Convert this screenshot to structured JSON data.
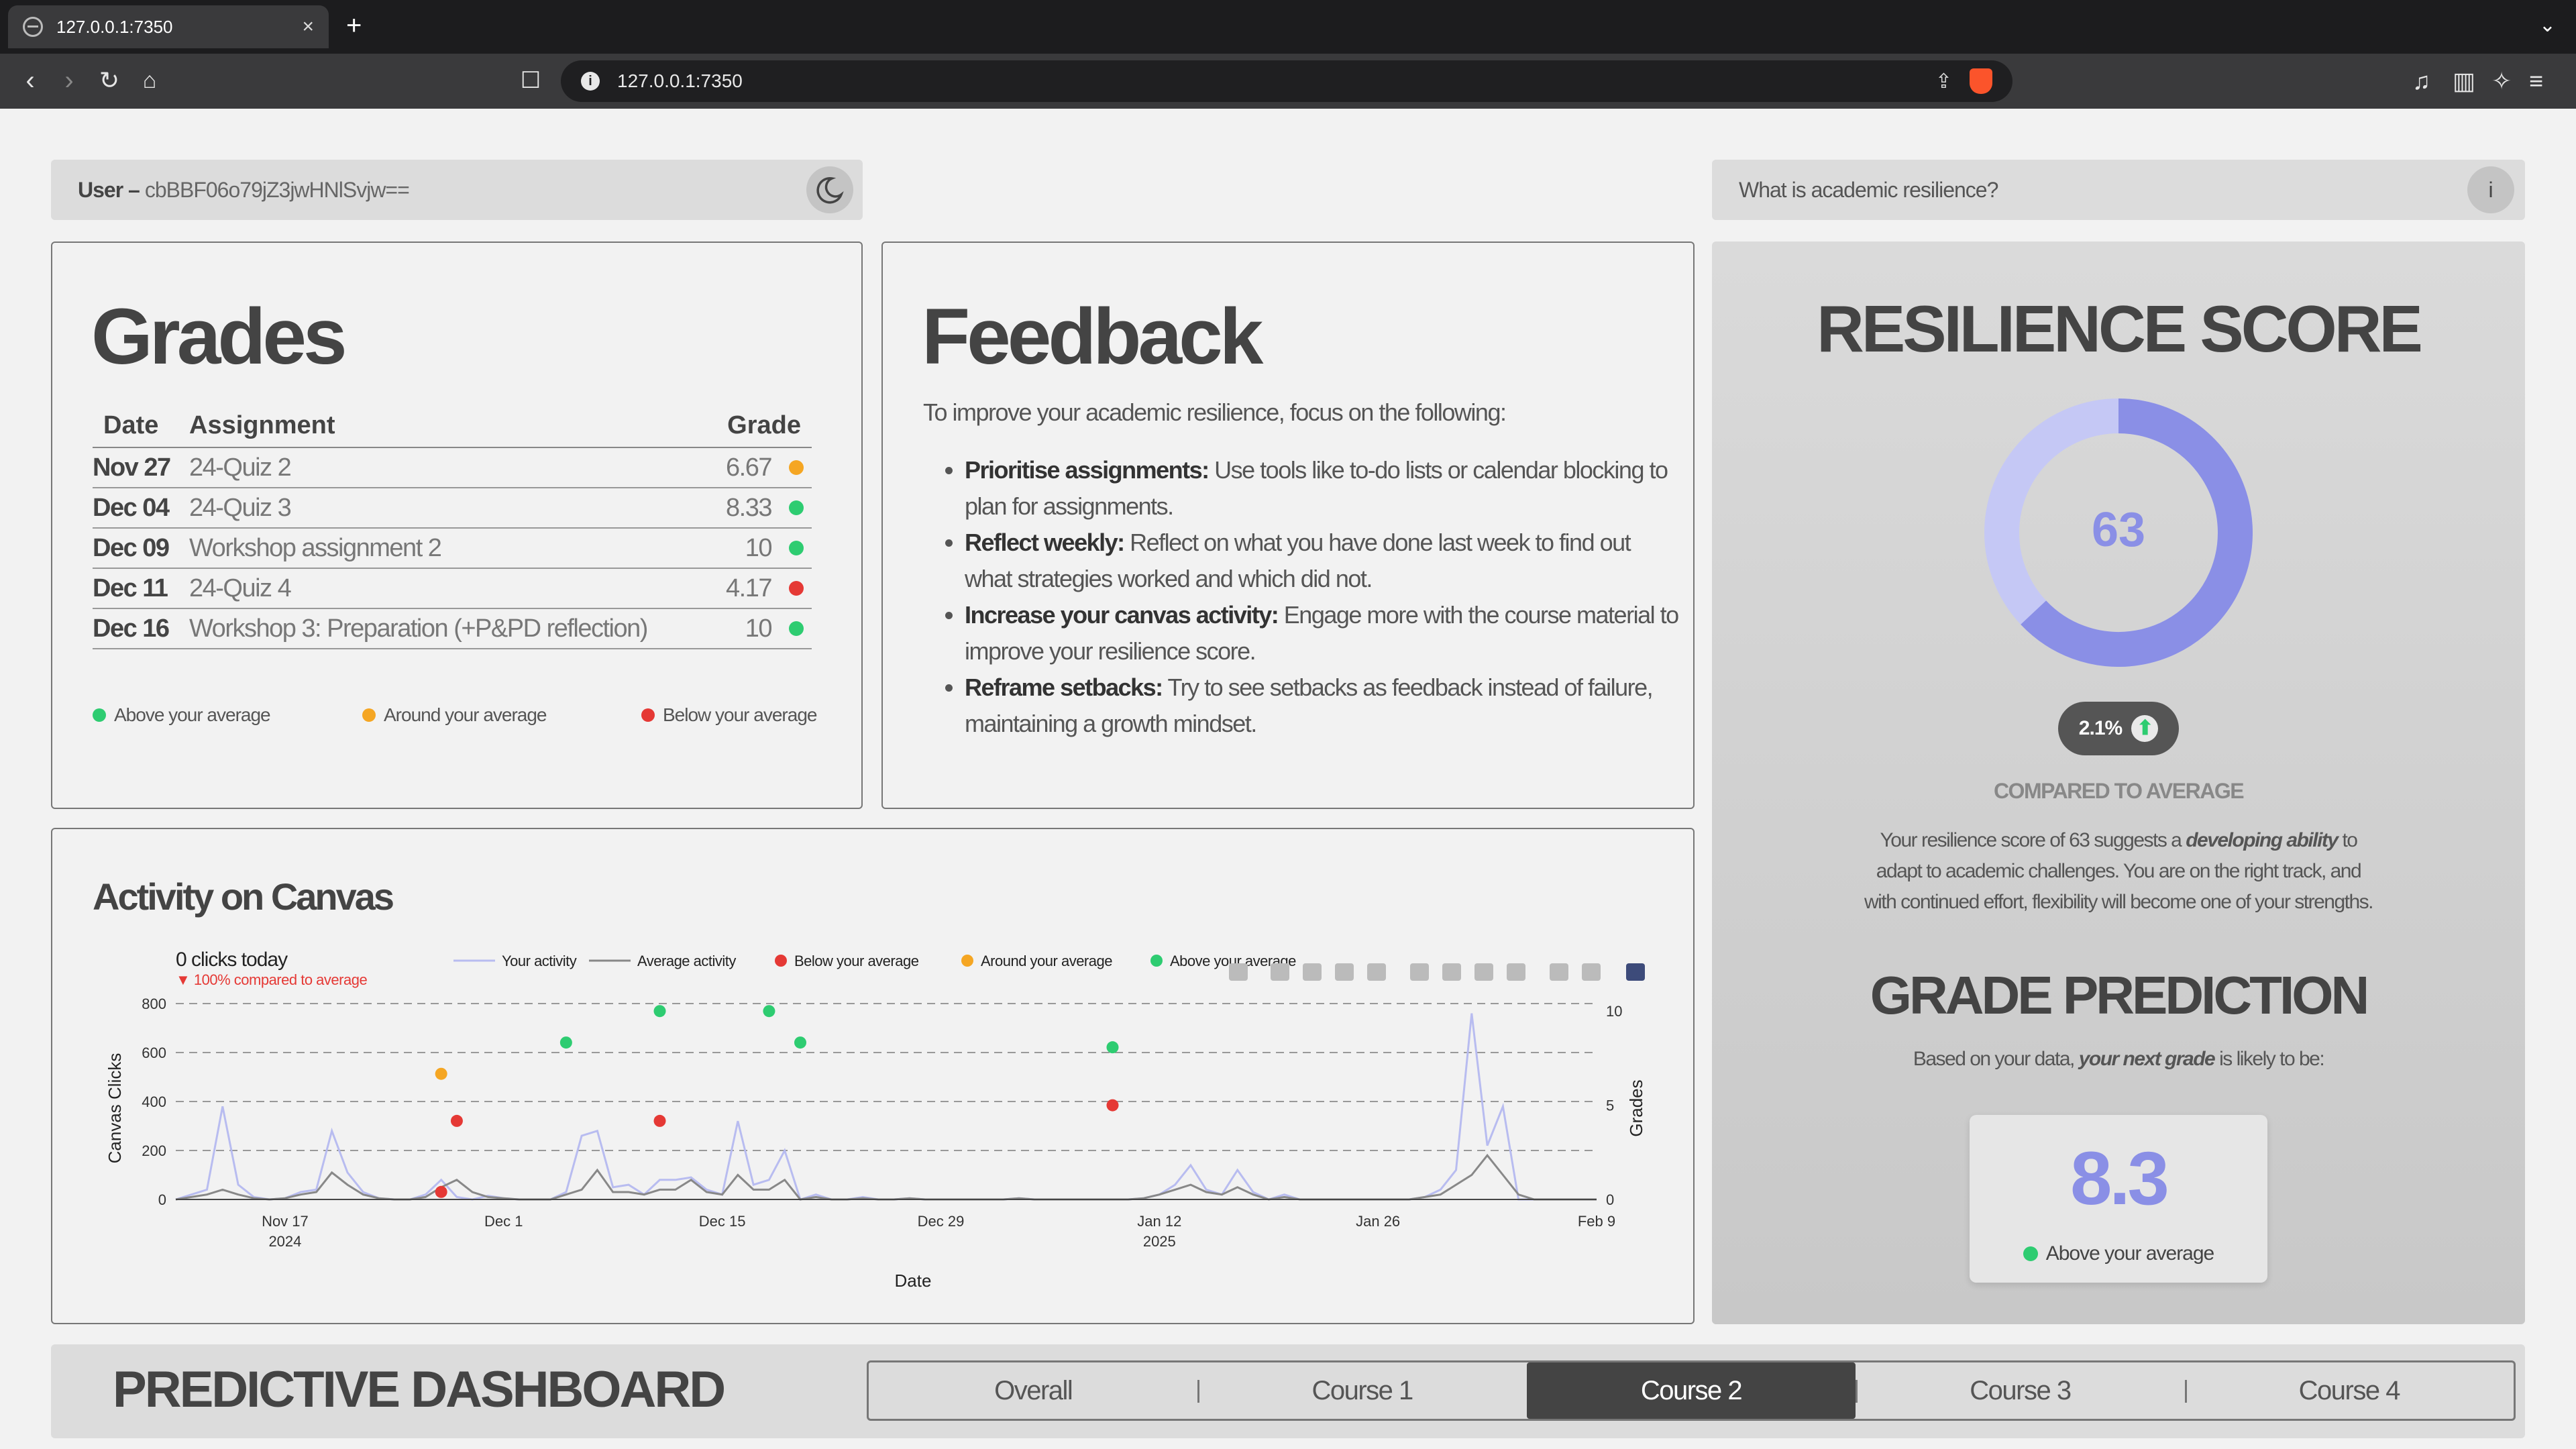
{
  "browser": {
    "tab_title": "127.0.0.1:7350",
    "url": "127.0.0.1:7350"
  },
  "user_bar": {
    "label": "User –",
    "id": "cbBBF06o79jZ3jwHNlSvjw=="
  },
  "info_bar": {
    "question": "What is academic resilience?"
  },
  "grades": {
    "title": "Grades",
    "headers": [
      "Date",
      "Assignment",
      "Grade"
    ],
    "rows": [
      {
        "date": "Nov 27",
        "assignment": "24-Quiz 2",
        "grade": "6.67",
        "status": "around"
      },
      {
        "date": "Dec 04",
        "assignment": "24-Quiz 3",
        "grade": "8.33",
        "status": "above"
      },
      {
        "date": "Dec 09",
        "assignment": "Workshop assignment 2",
        "grade": "10",
        "status": "above"
      },
      {
        "date": "Dec 11",
        "assignment": "24-Quiz 4",
        "grade": "4.17",
        "status": "below"
      },
      {
        "date": "Dec 16",
        "assignment": "Workshop 3: Preparation (+P&PD reflection)",
        "grade": "10",
        "status": "above"
      }
    ],
    "legend": {
      "above": "Above your average",
      "around": "Around your average",
      "below": "Below your average"
    }
  },
  "feedback": {
    "title": "Feedback",
    "intro": "To improve your academic resilience, focus on the following:",
    "items": [
      {
        "bold": "Prioritise assignments:",
        "text": " Use tools like to-do lists or calendar blocking to plan for assignments."
      },
      {
        "bold": "Reflect weekly:",
        "text": " Reflect on what you have done last week to find out what strategies worked and which did not."
      },
      {
        "bold": "Increase your canvas activity:",
        "text": " Engage more with the course material to improve your resilience score."
      },
      {
        "bold": "Reframe setbacks:",
        "text": " Try to see setbacks as feedback instead of failure, maintaining a growth mindset."
      }
    ]
  },
  "resilience": {
    "title": "RESILIENCE SCORE",
    "score": "63",
    "score_fraction": 0.63,
    "delta": "2.1%",
    "compared_label": "COMPARED TO AVERAGE",
    "desc_1": "Your resilience score of 63 suggests a",
    "desc_bold": "developing ability",
    "desc_2": "to",
    "desc_line2": "adapt to academic challenges. You are on the right track, and",
    "desc_line3": "with continued effort, flexibility will become one of your strengths.",
    "grade_title": "GRADE PREDICTION",
    "grade_intro_1": "Based on your data,",
    "grade_intro_bold": "your next grade",
    "grade_intro_2": "is likely to be:",
    "predicted_grade": "8.3",
    "predicted_status": "Above your average"
  },
  "activity": {
    "title": "Activity on Canvas",
    "clicks_today": "0 clicks today",
    "compare": "100% compared to average",
    "legend": [
      "Your activity",
      "Average activity",
      "Below your average",
      "Around your average",
      "Above your average"
    ],
    "ylabel_left": "Canvas Clicks",
    "ylabel_right": "Grades",
    "xlabel": "Date",
    "x_ticks": [
      "Nov 17",
      "Dec 1",
      "Dec 15",
      "Dec 29",
      "Jan 12",
      "Jan 26",
      "Feb 9"
    ],
    "x_years": [
      "2024",
      "",
      "",
      "",
      "2025",
      "",
      ""
    ],
    "y_left_ticks": [
      "0",
      "200",
      "400",
      "600",
      "800"
    ],
    "y_right_ticks": [
      "0",
      "5",
      "10"
    ]
  },
  "chart_data": {
    "type": "line",
    "x_start": "2024-11-10",
    "x_end": "2025-02-09",
    "ylim": [
      0,
      800
    ],
    "y2lim": [
      0,
      10.4
    ],
    "series": [
      {
        "name": "Your activity",
        "color": "#b8bcf0",
        "values": [
          0,
          20,
          40,
          380,
          60,
          10,
          0,
          5,
          30,
          40,
          280,
          110,
          30,
          5,
          0,
          0,
          20,
          80,
          10,
          0,
          15,
          5,
          0,
          0,
          0,
          30,
          260,
          280,
          50,
          60,
          20,
          80,
          80,
          90,
          40,
          20,
          320,
          60,
          80,
          200,
          0,
          20,
          0,
          0,
          10,
          0,
          0,
          5,
          0,
          0,
          0,
          0,
          0,
          0,
          5,
          0,
          0,
          0,
          0,
          0,
          0,
          0,
          5,
          20,
          60,
          140,
          40,
          20,
          120,
          30,
          0,
          20,
          0,
          0,
          0,
          0,
          0,
          0,
          0,
          0,
          10,
          40,
          120,
          760,
          220,
          380,
          0,
          0,
          0,
          0,
          0,
          0
        ]
      },
      {
        "name": "Average activity",
        "color": "#888888",
        "values": [
          0,
          10,
          20,
          40,
          20,
          5,
          0,
          5,
          20,
          30,
          110,
          60,
          20,
          5,
          0,
          0,
          10,
          50,
          80,
          30,
          10,
          5,
          0,
          0,
          0,
          20,
          40,
          120,
          30,
          30,
          20,
          40,
          40,
          80,
          30,
          20,
          100,
          40,
          40,
          80,
          0,
          10,
          0,
          0,
          5,
          0,
          0,
          5,
          0,
          0,
          0,
          0,
          0,
          0,
          5,
          0,
          0,
          0,
          0,
          0,
          0,
          0,
          5,
          20,
          40,
          60,
          30,
          20,
          50,
          20,
          0,
          10,
          0,
          0,
          0,
          0,
          0,
          0,
          0,
          0,
          10,
          20,
          60,
          100,
          180,
          100,
          20,
          0,
          0,
          0,
          0,
          0
        ]
      }
    ],
    "grade_points": [
      {
        "date": "2024-11-27",
        "grade": 0.4,
        "status": "below"
      },
      {
        "date": "2024-11-28",
        "grade": 4.17,
        "status": "below"
      },
      {
        "date": "2024-11-27",
        "grade": 6.67,
        "status": "around"
      },
      {
        "date": "2024-12-05",
        "grade": 8.33,
        "status": "above"
      },
      {
        "date": "2024-12-11",
        "grade": 10.0,
        "status": "above"
      },
      {
        "date": "2024-12-11",
        "grade": 4.17,
        "status": "below"
      },
      {
        "date": "2024-12-18",
        "grade": 10.0,
        "status": "above"
      },
      {
        "date": "2024-12-20",
        "grade": 8.33,
        "status": "above"
      },
      {
        "date": "2025-01-09",
        "grade": 8.08,
        "status": "above"
      },
      {
        "date": "2025-01-09",
        "grade": 5.0,
        "status": "below"
      }
    ],
    "colors": {
      "above": "#2ecc71",
      "around": "#f5a623",
      "below": "#e53935"
    }
  },
  "dashboard": {
    "title": "PREDICTIVE DASHBOARD",
    "tabs": [
      "Overall",
      "Course 1",
      "Course 2",
      "Course 3",
      "Course 4"
    ],
    "active_tab": "Course 2"
  }
}
